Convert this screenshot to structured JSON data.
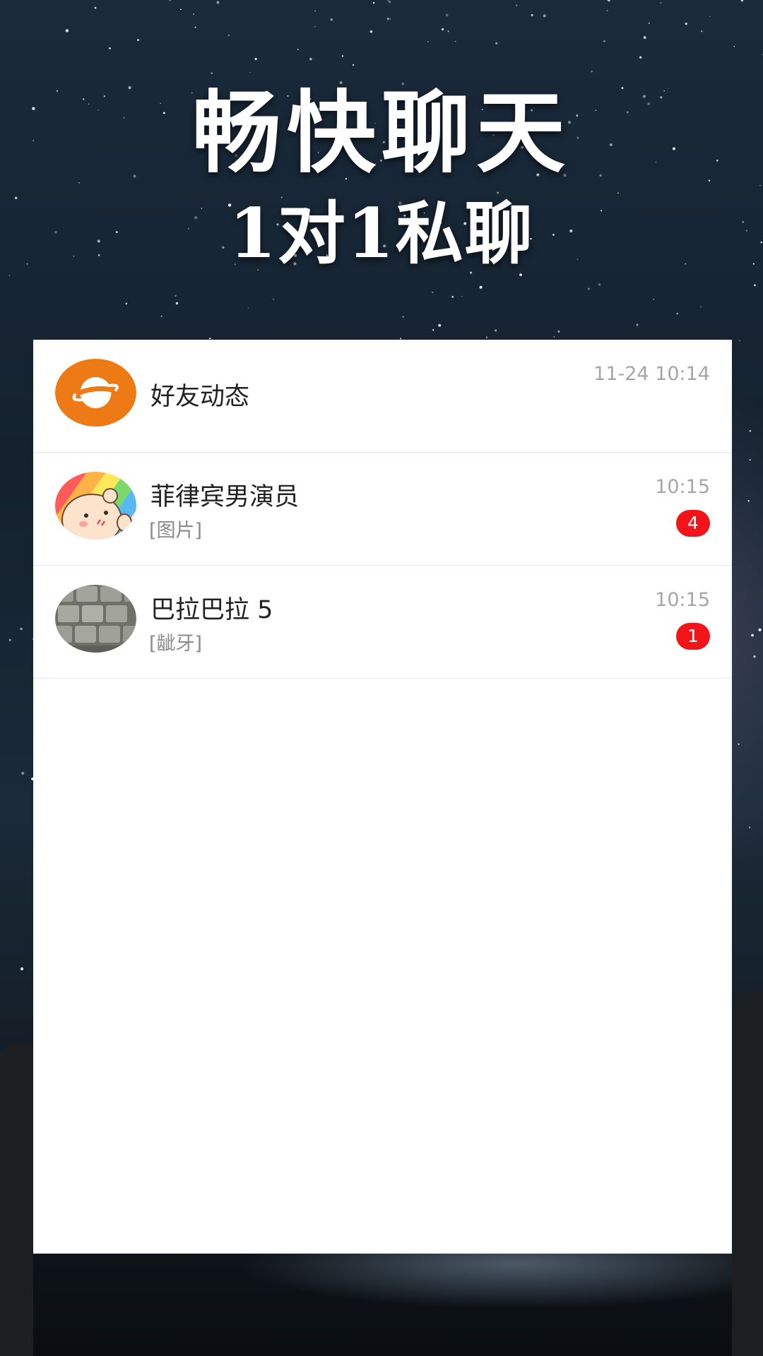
{
  "headline": {
    "main": "畅快聊天",
    "sub": "1对1私聊"
  },
  "colors": {
    "accent_orange": "#ee7a16",
    "badge_red": "#f21418",
    "time_gray": "#a6a6a6",
    "preview_gray": "#8a8a8a"
  },
  "conversations": [
    {
      "name": "好友动态",
      "preview": "",
      "time": "11-24 10:14",
      "unread": "",
      "icon": "planet-icon"
    },
    {
      "name": "菲律宾男演员",
      "preview": "[图片]",
      "time": "10:15",
      "unread": "4",
      "icon": "cartoon-pig-avatar"
    },
    {
      "name": "巴拉巴拉 5",
      "preview": "[龇牙]",
      "time": "10:15",
      "unread": "1",
      "icon": "keyboard-photo-avatar"
    }
  ]
}
